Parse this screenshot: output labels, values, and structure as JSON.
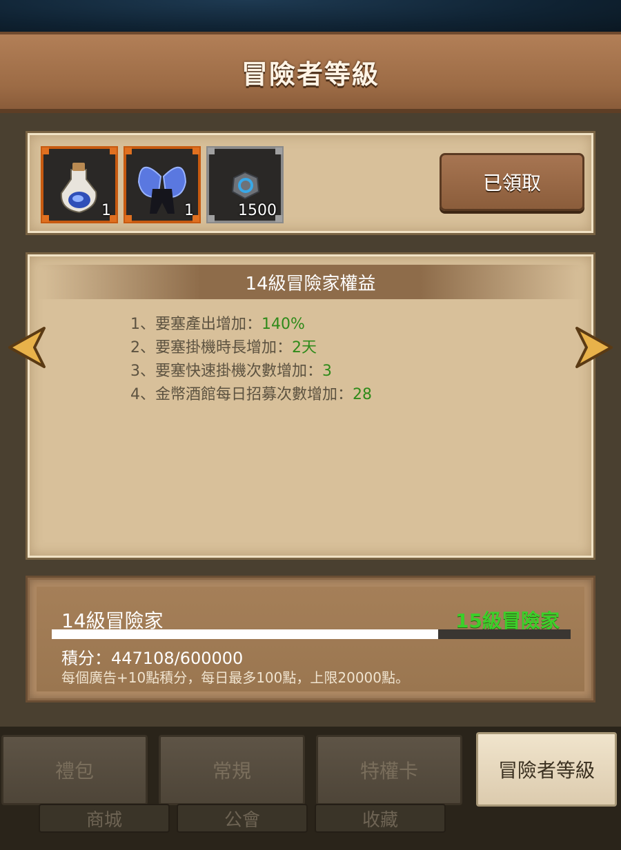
{
  "header": {
    "title": "冒險者等級"
  },
  "rewards": {
    "items": [
      {
        "name": "potion-bag-icon",
        "count": "1",
        "frame": "orange"
      },
      {
        "name": "crystal-wings-icon",
        "count": "1",
        "frame": "orange"
      },
      {
        "name": "rune-stone-icon",
        "count": "1500",
        "frame": "gray"
      }
    ],
    "claim_button": "已領取"
  },
  "benefits": {
    "title": "14級冒險家權益",
    "rows": [
      {
        "label": "1、要塞產出增加：",
        "value": "140%"
      },
      {
        "label": "2、要塞掛機時長增加：",
        "value": "2天"
      },
      {
        "label": "3、要塞快速掛機次數增加：",
        "value": "3"
      },
      {
        "label": "4、金幣酒館每日招募次數增加：",
        "value": "28"
      }
    ]
  },
  "progress": {
    "current_level": "14級冒險家",
    "next_level": "15級冒險家",
    "score_text": "積分：447108/600000",
    "score": 447108,
    "score_max": 600000,
    "note": "每個廣告+10點積分，每日最多100點，上限20000點。"
  },
  "tabs": [
    {
      "label": "禮包",
      "active": false
    },
    {
      "label": "常規",
      "active": false
    },
    {
      "label": "特權卡",
      "active": false
    },
    {
      "label": "冒險者等級",
      "active": true
    }
  ],
  "subtabs": [
    "商城",
    "公會",
    "收藏"
  ],
  "colors": {
    "accent_green": "#2f8a1a",
    "next_level_green": "#3ccf2a",
    "arrow_gold": "#e8b24a"
  }
}
